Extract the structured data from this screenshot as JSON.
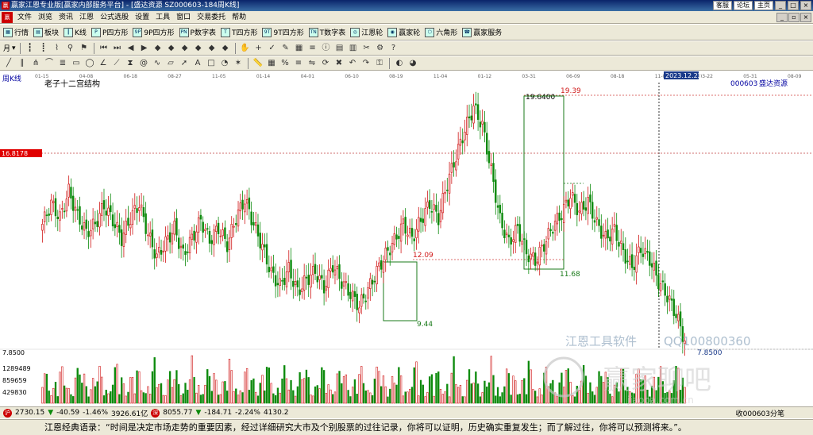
{
  "titlebar": {
    "title": "赢家江恩专业版[赢家内部服务平台] - [盛达资源  SZ000603-184周K线]",
    "links": [
      "客服",
      "论坛",
      "主页"
    ]
  },
  "menu": {
    "items": [
      "文件",
      "浏览",
      "资讯",
      "江恩",
      "公式选股",
      "设置",
      "工具",
      "窗口",
      "交易委托",
      "帮助"
    ]
  },
  "toolbar1": {
    "items": [
      "行情",
      "板块",
      "K线",
      "P四方形",
      "9P四方形",
      "P数字表",
      "T四方形",
      "9T四方形",
      "T数字表",
      "江恩轮",
      "赢家轮",
      "六角形",
      "赢家服务"
    ]
  },
  "toolbar2": {
    "period_label": "月"
  },
  "chart": {
    "period_label": "周K线",
    "indicator_title": "老子十二宫结构",
    "stock_code": "000603",
    "stock_name": "盛达资源",
    "crosshair_date": "2023.12.22",
    "price_tag": "16.8178",
    "date_ticks": [
      "01-15",
      "04-08",
      "06-18",
      "08-27",
      "11-05",
      "01-14",
      "04-01",
      "06-10",
      "08-19",
      "11-04",
      "01-12",
      "03-31",
      "06-09",
      "08-18",
      "11-03",
      "03-22",
      "05-31",
      "08-09"
    ],
    "labels": {
      "high": "19.6400",
      "upper_target": "19.39",
      "mid_level": "12.09",
      "low_a": "9.44",
      "low_b": "11.68",
      "last": "7.8500"
    },
    "volume_axis": [
      "7.8500",
      "1289489",
      "859659",
      "429830"
    ],
    "watermark_left": "江恩工具软件",
    "watermark_right": "QQ100800360",
    "watermark_big": "赢家聊吧",
    "watermark_small": "jiaoba.com.cn"
  },
  "chart_data": {
    "type": "candlestick",
    "title": "老子十二宫结构",
    "period": "weekly",
    "symbol": "000603 盛达资源",
    "y_range": [
      7.5,
      20.5
    ],
    "key_levels": {
      "high": 19.64,
      "upper_target": 19.39,
      "mid_level": 12.09,
      "low_a": 9.44,
      "low_b": 11.68,
      "last": 7.85,
      "price_tag": 16.8178
    },
    "close_path": [
      13.6,
      14.6,
      13.9,
      15.2,
      14.0,
      13.2,
      13.6,
      14.5,
      13.8,
      12.9,
      13.9,
      14.6,
      13.1,
      12.0,
      12.7,
      13.4,
      12.1,
      12.9,
      13.8,
      12.8,
      13.4,
      12.6,
      13.9,
      14.8,
      13.6,
      12.5,
      11.2,
      10.6,
      11.4,
      10.3,
      10.9,
      11.3,
      10.5,
      11.6,
      10.8,
      10.2,
      9.6,
      10.4,
      11.3,
      12.1,
      12.8,
      13.6,
      12.9,
      13.8,
      14.6,
      13.9,
      15.6,
      16.9,
      18.2,
      19.3,
      18.4,
      16.2,
      13.8,
      12.7,
      13.4,
      12.2,
      11.8,
      12.6,
      13.5,
      14.1,
      15.0,
      14.2,
      14.7,
      13.6,
      12.9,
      13.3,
      12.2,
      11.5,
      12.4,
      11.9,
      10.8,
      10.1,
      9.2,
      7.9
    ]
  },
  "status": {
    "sh_value": "2730.15",
    "sh_change": "-40.59",
    "sh_pct": "-1.46%",
    "sh_amount": "3926.61亿",
    "sz_value": "8055.77",
    "sz_change": "-184.71",
    "sz_pct": "-2.24%",
    "sz_amount": "4130.2",
    "right_text": "收000603分笔"
  },
  "quote_bar": {
    "text": "江恩经典语录：“时间是决定市场走势的重要因素，经过详细研究大市及个别股票的过往记录，你将可以证明，历史确实重复发生；而了解过往，你将可以预测将来。”。"
  },
  "colors": {
    "up": "#d01818",
    "down": "#0c8a0c",
    "ref_line": "#d0403c",
    "box": "#1a7a1a",
    "title_bg": "#0a246a"
  }
}
